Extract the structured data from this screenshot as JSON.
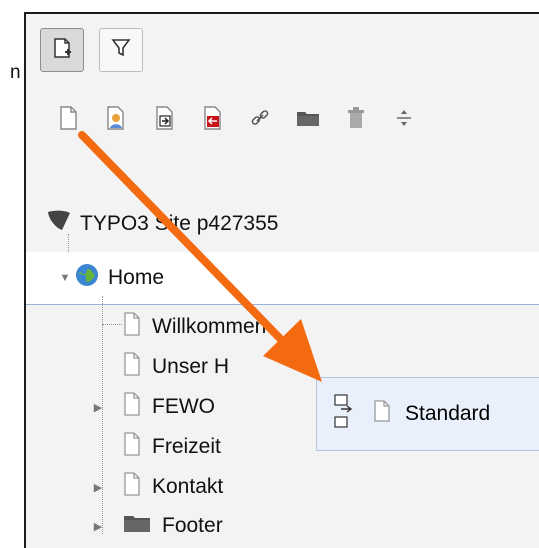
{
  "header": {
    "outer_text": "n"
  },
  "toolbar": {
    "new_page_icon": "new-page-icon",
    "filter_icon": "filter-icon",
    "icons": [
      "page-icon",
      "user-page-icon",
      "page-arrow-icon",
      "page-red-icon",
      "link-icon",
      "folder-icon",
      "trash-icon",
      "divider-icon"
    ]
  },
  "tree": {
    "site_label": "TYPO3 Site p427355",
    "home_label": "Home",
    "children": [
      {
        "label": "Willkommen"
      },
      {
        "label": "Unser H"
      },
      {
        "label": "FEWO"
      },
      {
        "label": "Freizeit"
      },
      {
        "label": "Kontakt"
      },
      {
        "label": "Footer"
      }
    ]
  },
  "popup": {
    "label": "Standard"
  },
  "colors": {
    "arrow": "#f36a10",
    "panel_bg": "#f3f3f3",
    "popup_bg": "#e9f0fb"
  }
}
